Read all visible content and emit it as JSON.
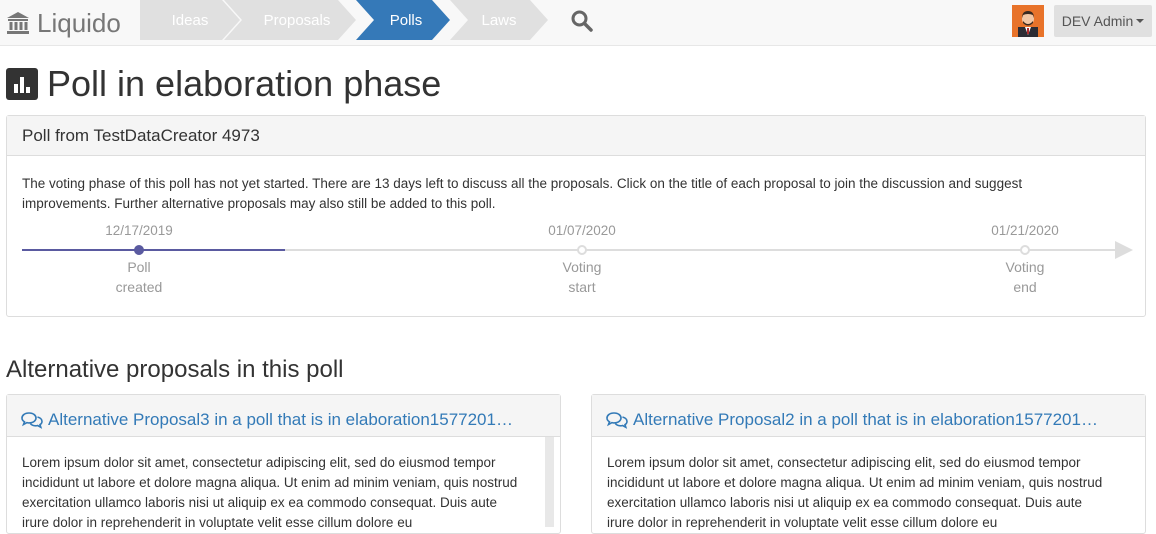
{
  "brand": {
    "name": "Liquido"
  },
  "nav": {
    "crumbs": [
      "Ideas",
      "Proposals",
      "Polls",
      "Laws"
    ],
    "active_index": 2,
    "search_icon": "search-icon",
    "user_label": "DEV Admin"
  },
  "page": {
    "title": "Poll in elaboration phase",
    "title_icon": "bar-chart-icon"
  },
  "poll": {
    "heading": "Poll from TestDataCreator 4973",
    "description": "The voting phase of this poll has not yet started. There are 13 days left to discuss all the proposals. Click on the title of each proposal to join the discussion and suggest improvements. Further alternative proposals may also still be added to this poll.",
    "timeline": {
      "progress": 0.24,
      "points": [
        {
          "date": "12/17/2019",
          "label_line1": "Poll",
          "label_line2": "created"
        },
        {
          "date": "01/07/2020",
          "label_line1": "Voting",
          "label_line2": "start"
        },
        {
          "date": "01/21/2020",
          "label_line1": "Voting",
          "label_line2": "end"
        }
      ]
    },
    "colors": {
      "progress": "#5a5aa0",
      "track": "#dddddd"
    }
  },
  "section": {
    "title": "Alternative proposals in this poll"
  },
  "proposals": [
    {
      "title": "Alternative Proposal3 in a poll that is in elaboration1577201…",
      "body": "Lorem ipsum dolor sit amet, consectetur adipiscing elit, sed do eiusmod tempor incididunt ut labore et dolore magna aliqua. Ut enim ad minim veniam, quis nostrud exercitation ullamco laboris nisi ut aliquip ex ea commodo consequat. Duis aute irure dolor in reprehenderit in voluptate velit esse cillum dolore eu"
    },
    {
      "title": "Alternative Proposal2 in a poll that is in elaboration1577201…",
      "body": "Lorem ipsum dolor sit amet, consectetur adipiscing elit, sed do eiusmod tempor incididunt ut labore et dolore magna aliqua. Ut enim ad minim veniam, quis nostrud exercitation ullamco laboris nisi ut aliquip ex ea commodo consequat. Duis aute irure dolor in reprehenderit in voluptate velit esse cillum dolore eu"
    }
  ]
}
